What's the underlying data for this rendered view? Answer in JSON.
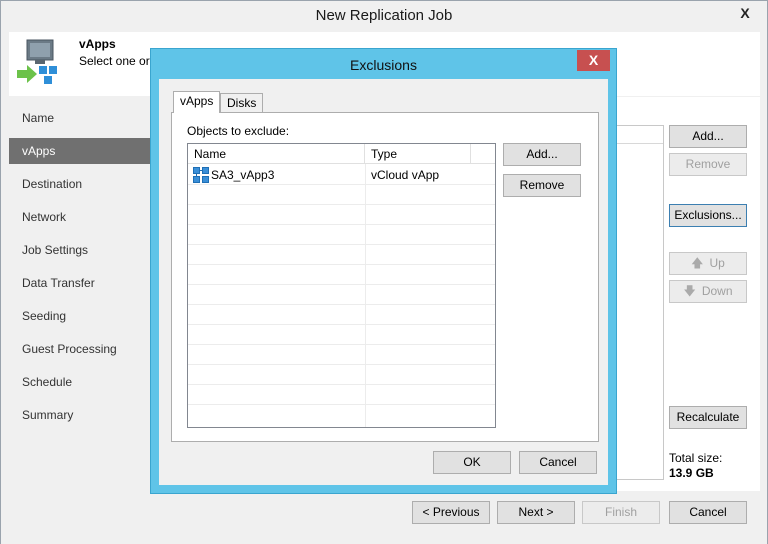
{
  "window": {
    "title": "New Replication Job",
    "close_label": "X"
  },
  "header": {
    "title": "vApps",
    "description": "Select one or"
  },
  "sidebar": {
    "items": [
      {
        "label": "Name",
        "active": false
      },
      {
        "label": "vApps",
        "active": true
      },
      {
        "label": "Destination",
        "active": false
      },
      {
        "label": "Network",
        "active": false
      },
      {
        "label": "Job Settings",
        "active": false
      },
      {
        "label": "Data Transfer",
        "active": false
      },
      {
        "label": "Seeding",
        "active": false
      },
      {
        "label": "Guest Processing",
        "active": false
      },
      {
        "label": "Schedule",
        "active": false
      },
      {
        "label": "Summary",
        "active": false
      }
    ]
  },
  "right_buttons": {
    "add": "Add...",
    "remove": "Remove",
    "exclusions": "Exclusions...",
    "up": "Up",
    "down": "Down",
    "recalculate": "Recalculate"
  },
  "total": {
    "label": "Total size:",
    "value": "13.9 GB"
  },
  "footer": {
    "previous": "< Previous",
    "next": "Next >",
    "finish": "Finish",
    "cancel": "Cancel"
  },
  "dialog": {
    "title": "Exclusions",
    "close_label": "X",
    "tabs": [
      {
        "label": "vApps",
        "active": true
      },
      {
        "label": "Disks",
        "active": false
      }
    ],
    "objects_label": "Objects to exclude:",
    "columns": [
      "Name",
      "Type"
    ],
    "rows": [
      {
        "name": "SA3_vApp3",
        "type": "vCloud vApp",
        "icon": "vapp-icon"
      }
    ],
    "add_label": "Add...",
    "remove_label": "Remove",
    "ok_label": "OK",
    "cancel_label": "Cancel"
  },
  "colors": {
    "dialog_frame": "#5fc4e8",
    "dialog_close": "#c75050",
    "active_step": "#707070"
  }
}
